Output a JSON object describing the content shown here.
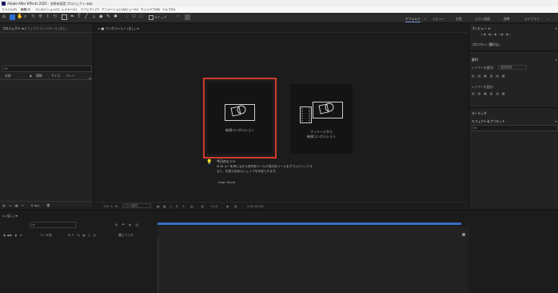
{
  "window": {
    "title": "Adobe After Effects 2025 - 名称未設定プロジェクト.aep"
  },
  "menu": [
    "ファイル(F)",
    "編集(E)",
    "コンポジション(C)",
    "レイヤー(L)",
    "エフェクト(T)",
    "アニメーション(A)",
    "ビュー(V)",
    "ウィンドウ(W)",
    "ヘルプ(H)"
  ],
  "toolbar": {
    "snap_label": "スナップ"
  },
  "workspaces": [
    "デフォルト",
    "レビュー",
    "学習",
    "小さい画面",
    "標準",
    "ライブラリ"
  ],
  "project_panel": {
    "tabs": [
      "プロジェクト ≡",
      "エフェクトコントロール (なし)"
    ],
    "search_placeholder": "Q▾",
    "columns": [
      "名前",
      "種類",
      "サイズ",
      "フレー"
    ],
    "footer_bpc": "8 bpc"
  },
  "comp_panel": {
    "tab": "× ■ コンポジション (なし) ≡",
    "new_comp_label": "新規コンポジション",
    "footage_comp_label_line1": "フッテージから",
    "footage_comp_label_line2": "新規コンポジション",
    "tip_title": "今日のヒント",
    "tip_body_line1": "Shift キーを押しながら長円形ツールや長方形ツールをダブルクリックす",
    "tip_body_line2": "ると、任意の形状のシェイプを作成できます。",
    "tip_author": "- Evan Shore",
    "footer_zoom": "100 %",
    "footer_res": "(フル画質)",
    "footer_time": "0:00:00:00",
    "footer_more": "+0.0"
  },
  "right_panel": {
    "preview_tab": "プレビュー ≡",
    "properties_tab": "プロパティ: 選択なし",
    "align_tab": "整列",
    "align_to_label": "レイヤーを整列:",
    "align_to_value": "選択範囲",
    "distribute_label": "レイヤーを配分:",
    "audio_tab": "オーディオ",
    "effects_tab": "エフェクト＆プリセット",
    "effects_search": "Q▾"
  },
  "timeline": {
    "tab": "× (なし) ≡",
    "search_placeholder": "Q▾",
    "columns": [
      "ソース名",
      "親とリンク"
    ]
  }
}
